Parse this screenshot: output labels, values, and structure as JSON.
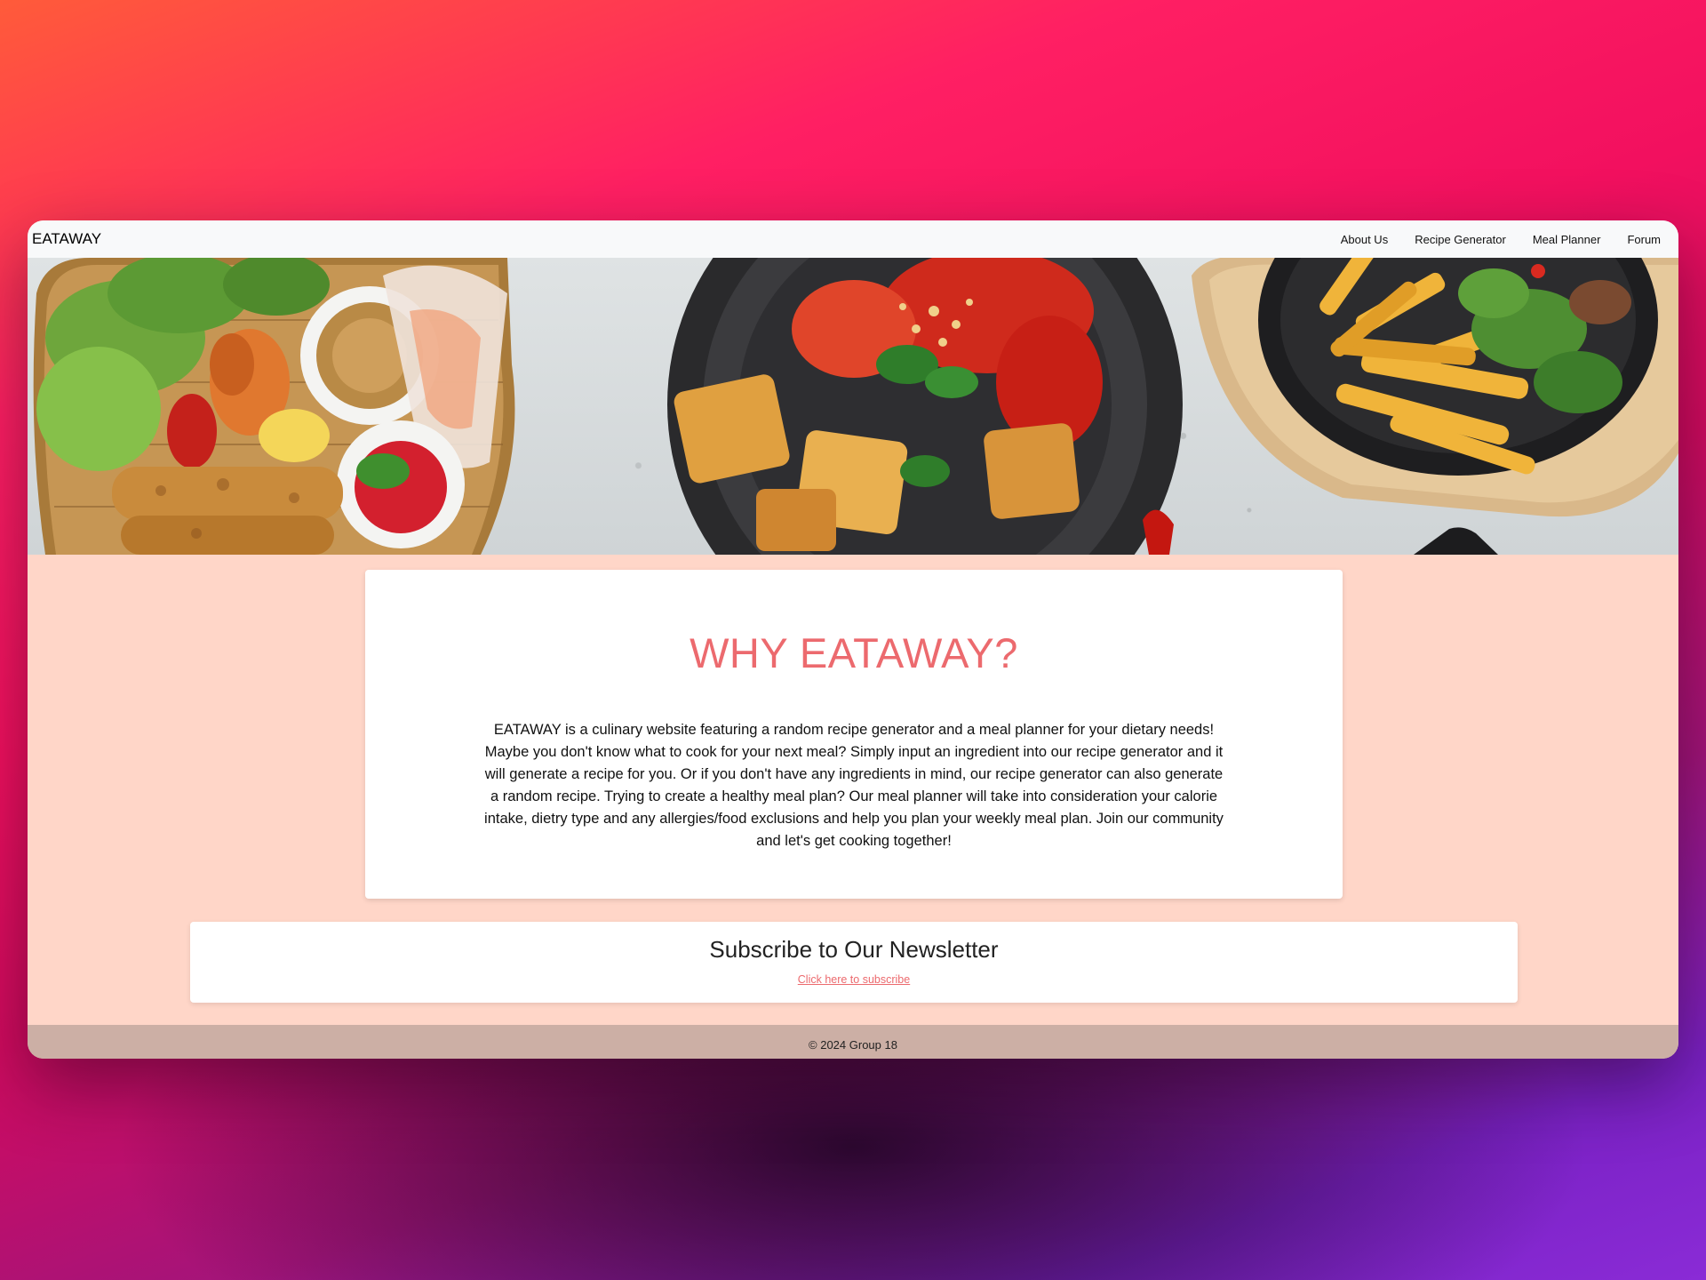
{
  "navbar": {
    "brand": "EATAWAY",
    "links": [
      {
        "label": "About Us"
      },
      {
        "label": "Recipe Generator"
      },
      {
        "label": "Meal Planner"
      },
      {
        "label": "Forum"
      }
    ]
  },
  "hero": {
    "description": ""
  },
  "why": {
    "title": "WHY EATAWAY?",
    "body": "EATAWAY is a culinary website featuring a random recipe generator and a meal planner for your dietary needs! Maybe you don't know what to cook for your next meal? Simply input an ingredient into our recipe generator and it will generate a recipe for you. Or if you don't have any ingredients in mind, our recipe generator can also generate a random recipe. Trying to create a healthy meal plan? Our meal planner will take into consideration your calorie intake, dietry type and any allergies/food exclusions and help you plan your weekly meal plan. Join our community and let's get cooking together!"
  },
  "newsletter": {
    "title": "Subscribe to Our Newsletter",
    "link": "Click here to subscribe"
  },
  "footer": {
    "text": "© 2024 Group 18"
  },
  "colors": {
    "accent": "#ec6a6e",
    "page_bg": "#ffd6c8",
    "footer_bg": "#ccafa5",
    "navbar_bg": "#f8f9fa"
  }
}
